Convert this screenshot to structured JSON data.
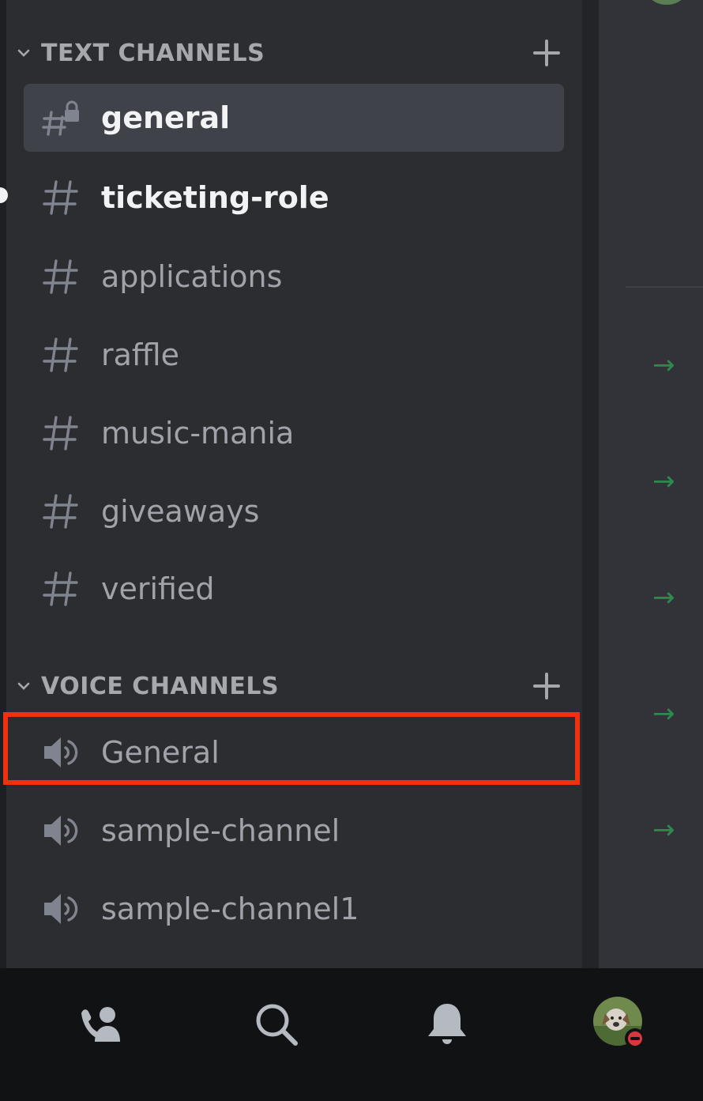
{
  "sections": {
    "text": {
      "label": "TEXT CHANNELS"
    },
    "voice": {
      "label": "VOICE CHANNELS"
    }
  },
  "text_channels": [
    {
      "name": "general",
      "icon": "locked-hashtag-icon",
      "selected": true
    },
    {
      "name": "ticketing-role",
      "icon": "hashtag-icon",
      "unread": true
    },
    {
      "name": "applications",
      "icon": "hashtag-icon"
    },
    {
      "name": "raffle",
      "icon": "hashtag-icon"
    },
    {
      "name": "music-mania",
      "icon": "hashtag-icon"
    },
    {
      "name": "giveaways",
      "icon": "hashtag-icon"
    },
    {
      "name": "verified",
      "icon": "hashtag-icon"
    }
  ],
  "voice_channels": [
    {
      "name": "General",
      "icon": "speaker-icon",
      "highlighted": true
    },
    {
      "name": "sample-channel",
      "icon": "speaker-icon"
    },
    {
      "name": "sample-channel1",
      "icon": "speaker-icon"
    }
  ],
  "right_pane": {
    "arrow_glyph": "→"
  },
  "bottom_nav": [
    "friends-icon",
    "search-icon",
    "bell-icon",
    "avatar"
  ],
  "colors": {
    "highlight_border": "#f1300f",
    "arrow": "#2d8a4e",
    "status_dnd": "#da373c"
  }
}
